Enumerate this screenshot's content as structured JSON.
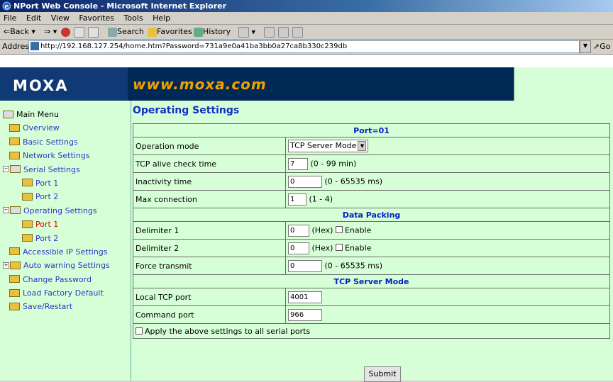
{
  "window": {
    "title": "NPort Web Console - Microsoft Internet Explorer"
  },
  "menu": [
    "File",
    "Edit",
    "View",
    "Favorites",
    "Tools",
    "Help"
  ],
  "toolbar": {
    "back": "Back",
    "search": "Search",
    "favorites": "Favorites",
    "history": "History"
  },
  "address": {
    "label": "Address",
    "url": "http://192.168.127.254/home.htm?Password=731a9e0a41ba3bb0a27ca8b330c239db",
    "go": "Go"
  },
  "header": {
    "logo": "MOXA",
    "site": "www.moxa.com"
  },
  "sidebar": {
    "items": [
      {
        "label": "Main Menu"
      },
      {
        "label": "Overview"
      },
      {
        "label": "Basic Settings"
      },
      {
        "label": "Network Settings"
      },
      {
        "label": "Serial Settings"
      },
      {
        "label": "Port 1"
      },
      {
        "label": "Port 2"
      },
      {
        "label": "Operating Settings"
      },
      {
        "label": "Port 1"
      },
      {
        "label": "Port 2"
      },
      {
        "label": "Accessible IP Settings"
      },
      {
        "label": "Auto warning Settings"
      },
      {
        "label": "Change Password"
      },
      {
        "label": "Load Factory Default"
      },
      {
        "label": "Save/Restart"
      }
    ]
  },
  "main": {
    "title": "Operating Settings",
    "port_header": "Port=01",
    "rows": {
      "operation_mode": {
        "label": "Operation mode",
        "value": "TCP Server Mode"
      },
      "tcp_alive": {
        "label": "TCP alive check time",
        "value": "7",
        "hint": "(0 - 99 min)"
      },
      "inactivity": {
        "label": "Inactivity time",
        "value": "0",
        "hint": "(0 - 65535 ms)"
      },
      "max_connection": {
        "label": "Max connection",
        "value": "1",
        "hint": "(1 - 4)"
      }
    },
    "data_packing": "Data Packing",
    "packing": {
      "delimiter1": {
        "label": "Delimiter 1",
        "value": "0",
        "hint": "(Hex)",
        "enable": "Enable"
      },
      "delimiter2": {
        "label": "Delimiter 2",
        "value": "0",
        "hint": "(Hex)",
        "enable": "Enable"
      },
      "force_transmit": {
        "label": "Force transmit",
        "value": "0",
        "hint": "(0 - 65535 ms)"
      }
    },
    "tcp_server_mode": "TCP Server Mode",
    "server": {
      "local_tcp_port": {
        "label": "Local TCP port",
        "value": "4001"
      },
      "command_port": {
        "label": "Command port",
        "value": "966"
      }
    },
    "apply_all": "Apply the above settings to all serial ports",
    "submit": "Submit"
  }
}
